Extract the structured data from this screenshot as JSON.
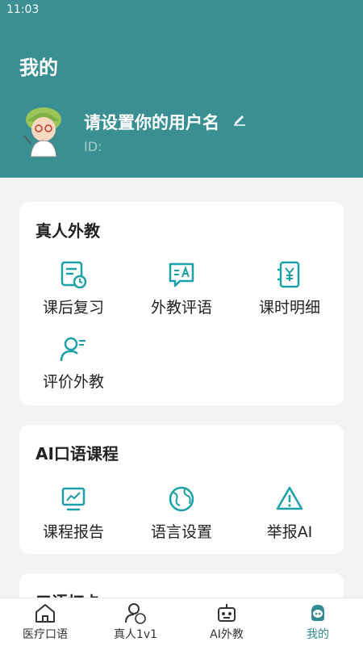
{
  "status_bar": {
    "time": "11:03"
  },
  "header": {
    "title": "我的",
    "username": "请设置你的用户名",
    "id_label": "ID:"
  },
  "cards": {
    "tutor": {
      "title": "真人外教",
      "items": [
        {
          "label": "课后复习",
          "icon": "review-icon"
        },
        {
          "label": "外教评语",
          "icon": "comment-icon"
        },
        {
          "label": "课时明细",
          "icon": "class-hours-icon"
        },
        {
          "label": "评价外教",
          "icon": "rate-tutor-icon"
        }
      ]
    },
    "ai": {
      "title": "AI口语课程",
      "items": [
        {
          "label": "课程报告",
          "icon": "report-icon"
        },
        {
          "label": "语言设置",
          "icon": "globe-icon"
        },
        {
          "label": "举报AI",
          "icon": "warning-icon"
        }
      ]
    },
    "third": {
      "title": "口语打卡"
    }
  },
  "tabbar": {
    "items": [
      {
        "label": "医疗口语",
        "icon": "home-icon"
      },
      {
        "label": "真人1v1",
        "icon": "tutor-person-icon"
      },
      {
        "label": "AI外教",
        "icon": "robot-icon"
      },
      {
        "label": "我的",
        "icon": "profile-icon",
        "active": true
      }
    ]
  },
  "colors": {
    "primary": "#3a8f93",
    "accent": "#1aa0a6",
    "background": "#f3f3f3"
  }
}
